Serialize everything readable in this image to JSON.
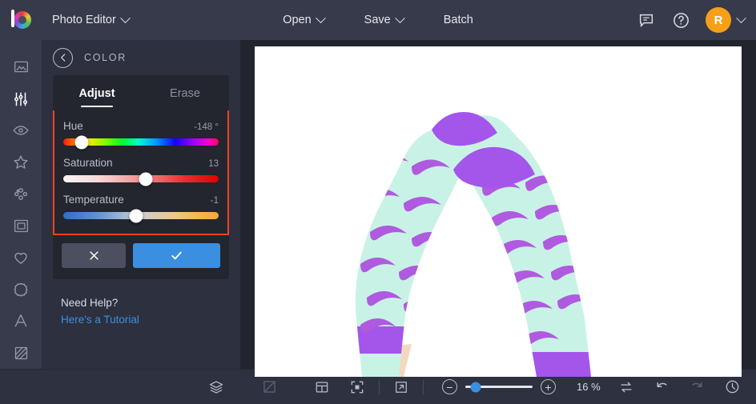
{
  "app": {
    "logo_name": "befunky-logo",
    "title": "Photo Editor",
    "accent_blue": "#3b8fe0",
    "highlight_red": "#f0431c",
    "avatar_color": "#f5a019"
  },
  "topbar": {
    "menu_items": [
      {
        "label": "Open",
        "has_caret": true
      },
      {
        "label": "Save",
        "has_caret": true
      },
      {
        "label": "Batch",
        "has_caret": false
      }
    ],
    "icons": [
      {
        "name": "feedback-icon"
      },
      {
        "name": "help-icon"
      }
    ],
    "avatar_initial": "R"
  },
  "rail": {
    "items": [
      {
        "name": "image-icon",
        "active": false
      },
      {
        "name": "sliders-icon",
        "active": true
      },
      {
        "name": "eye-icon",
        "active": false
      },
      {
        "name": "star-icon",
        "active": false
      },
      {
        "name": "retouch-icon",
        "active": false
      },
      {
        "name": "frame-icon",
        "active": false
      },
      {
        "name": "heart-icon",
        "active": false
      },
      {
        "name": "sticker-icon",
        "active": false
      },
      {
        "name": "text-icon",
        "active": false
      },
      {
        "name": "texture-icon",
        "active": false
      }
    ]
  },
  "panel": {
    "back_label": "Back",
    "title": "COLOR",
    "tabs": [
      {
        "label": "Adjust",
        "active": true
      },
      {
        "label": "Erase",
        "active": false
      }
    ],
    "sliders": [
      {
        "name": "hue",
        "label": "Hue",
        "value": "-148 °",
        "percent": 12
      },
      {
        "name": "saturation",
        "label": "Saturation",
        "value": "13",
        "percent": 53
      },
      {
        "name": "temperature",
        "label": "Temperature",
        "value": "-1",
        "percent": 47
      }
    ],
    "cancel_label": "✕",
    "apply_label": "✓",
    "help_title": "Need Help?",
    "help_link": "Here's a Tutorial"
  },
  "bottombar": {
    "left_icons": [
      {
        "name": "layers-icon",
        "dim": false
      },
      {
        "name": "crop-icon",
        "dim": true
      },
      {
        "name": "layout-icon",
        "dim": false
      },
      {
        "name": "fit-screen-icon",
        "dim": false
      },
      {
        "name": "fullscreen-icon",
        "dim": false
      }
    ],
    "zoom": {
      "minus_label": "−",
      "plus_label": "+",
      "percent_label": "16 %",
      "slider_percent": 15
    },
    "right_icons": [
      {
        "name": "compare-icon",
        "dim": false
      },
      {
        "name": "undo-icon",
        "dim": false
      },
      {
        "name": "redo-icon",
        "dim": true
      },
      {
        "name": "history-icon",
        "dim": false
      }
    ]
  },
  "canvas": {
    "image_alt": "mint-green socks with purple banana pattern"
  }
}
